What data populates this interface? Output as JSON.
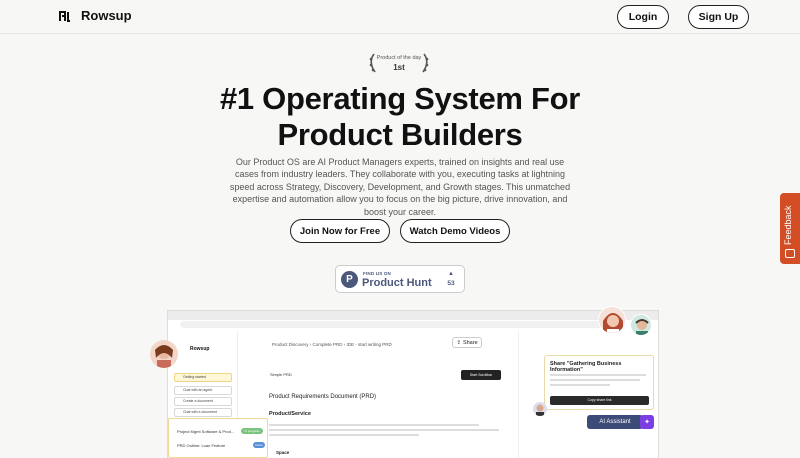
{
  "nav": {
    "brand": "Rowsup",
    "login": "Login",
    "signup": "Sign Up"
  },
  "badge": {
    "line1": "Product of the day",
    "line2": "1st"
  },
  "hero": {
    "headline_line1": "#1 Operating System For",
    "headline_line2": "Product Builders",
    "subtitle": "Our Product OS are AI Product Managers experts, trained on insights and real use cases from industry leaders. They collaborate with you, executing tasks at lightning speed across Strategy, Discovery, Development, and Growth stages. This unmatched expertise and automation allow you to focus on the big picture, drive innovation, and boost your career."
  },
  "cta": {
    "primary": "Join Now for Free",
    "secondary": "Watch Demo Videos"
  },
  "product_hunt": {
    "label": "FIND US ON",
    "name": "Product Hunt",
    "votes": "53",
    "logo_letter": "P"
  },
  "feedback": {
    "label": "Feedback"
  },
  "preview": {
    "sidebar_title": "Rowsup",
    "sidebar_items": [
      "Getting started",
      "Chat with an agent",
      "Create a document",
      "Chat with a document"
    ],
    "breadcrumb": "Product Discovery  ›  Complete PRD  ›  IDE - start writing PRD",
    "simple_prd": "Simple PRD",
    "dark_button": "Start Scrollbar",
    "doc_title": "Product Requirements Document (PRD)",
    "doc_heading": "Product/Service",
    "share": "Share",
    "card_title": "Share \"Gathering Business Information\"",
    "card_button": "Copy share link",
    "ai_assistant": "AI Assistant",
    "list_rows": [
      "Project Mgmt Software & Prod...",
      "PRD Outline: Loan Feature"
    ],
    "list_pills": [
      "In progress",
      "Done"
    ],
    "space_label": "Space"
  }
}
